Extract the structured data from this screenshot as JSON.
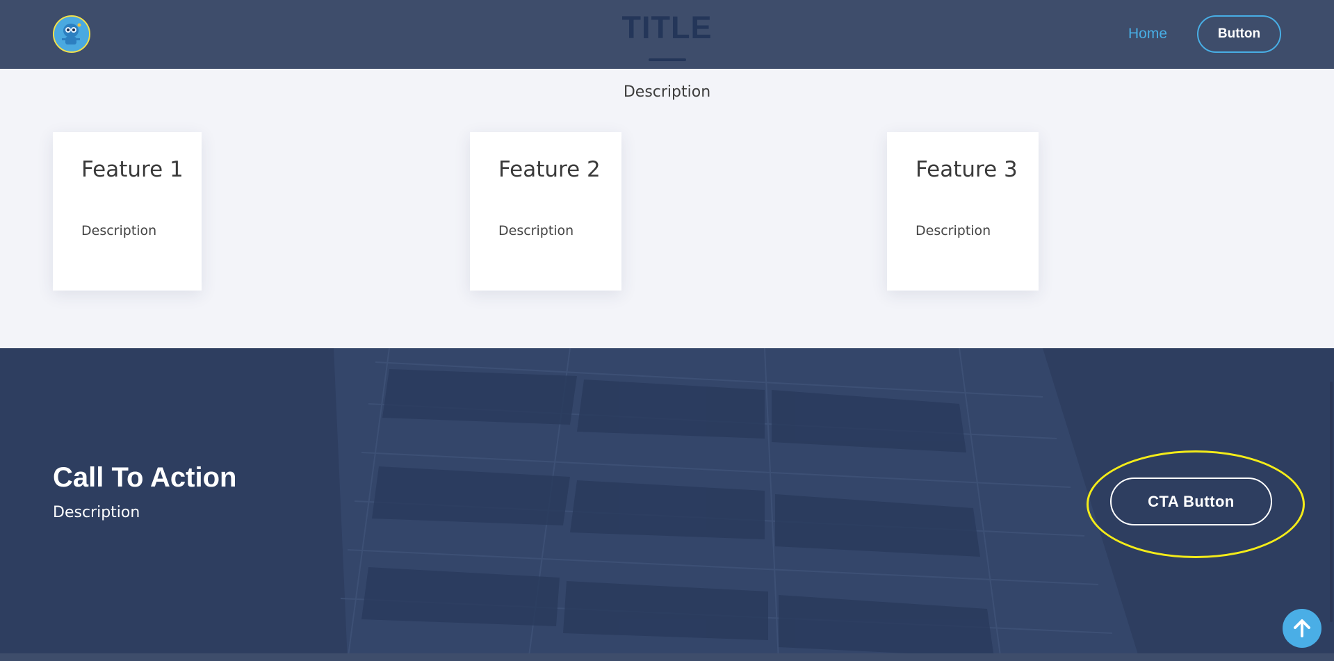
{
  "header": {
    "title": "TITLE",
    "nav_home": "Home",
    "button_label": "Button",
    "logo_icon": "robot-logo-icon"
  },
  "features": {
    "description": "Description",
    "cards": [
      {
        "title": "Feature 1",
        "description": "Description"
      },
      {
        "title": "Feature 2",
        "description": "Description"
      },
      {
        "title": "Feature 3",
        "description": "Description"
      }
    ]
  },
  "cta": {
    "heading": "Call To Action",
    "description": "Description",
    "button_label": "CTA Button"
  },
  "scroll_top_icon": "arrow-up-icon",
  "colors": {
    "header_bg": "#3e4d6b",
    "accent": "#48aee5",
    "title": "#243659",
    "page_bg": "#f3f4f9",
    "cta_bg": "#2e3e60",
    "highlight": "#f4ec19"
  }
}
